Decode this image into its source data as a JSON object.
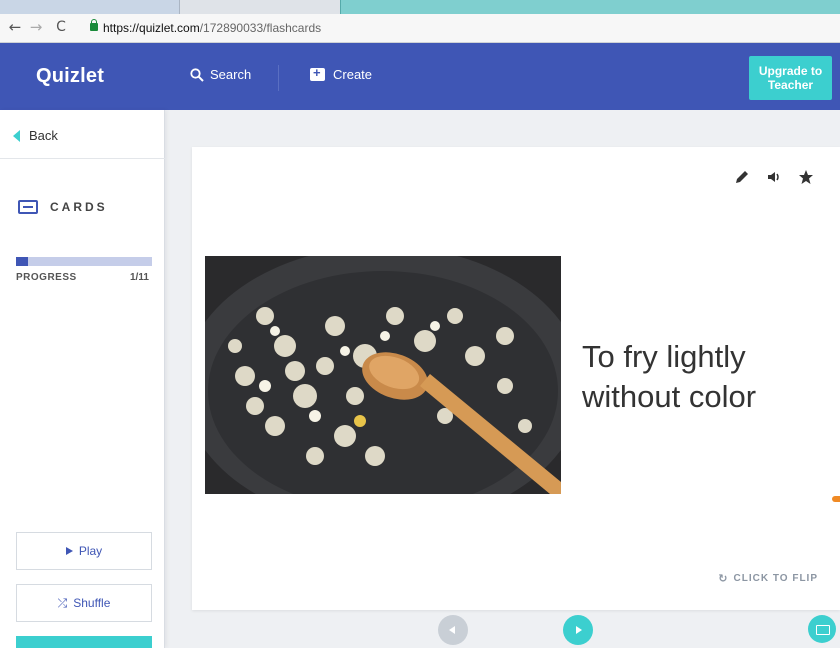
{
  "browser": {
    "url_host": "https://quizlet.com",
    "url_path": "/172890033/flashcards"
  },
  "header": {
    "logo": "Quizlet",
    "search_label": "Search",
    "create_label": "Create",
    "upgrade_label": "Upgrade to Teacher"
  },
  "sidebar": {
    "back_label": "Back",
    "mode_label": "CARDS",
    "progress_label": "PROGRESS",
    "progress_count": "1/11",
    "progress_fraction": 0.0909,
    "play_label": "Play",
    "shuffle_label": "Shuffle"
  },
  "card": {
    "term": "To fry lightly without color",
    "flip_label": "CLICK TO FLIP",
    "image_icon": "onions-in-skillet-photo"
  },
  "colors": {
    "brand_blue": "#3f56b5",
    "teal": "#3ccfcf"
  },
  "icons": {
    "search": "search-icon",
    "create": "create-set-icon",
    "back": "back-arrow-icon",
    "cards": "cards-icon",
    "edit": "pencil-icon",
    "audio": "speaker-icon",
    "star": "star-icon",
    "flip": "flip-icon",
    "play": "play-icon",
    "shuffle": "shuffle-icon",
    "keyboard": "keyboard-icon"
  }
}
